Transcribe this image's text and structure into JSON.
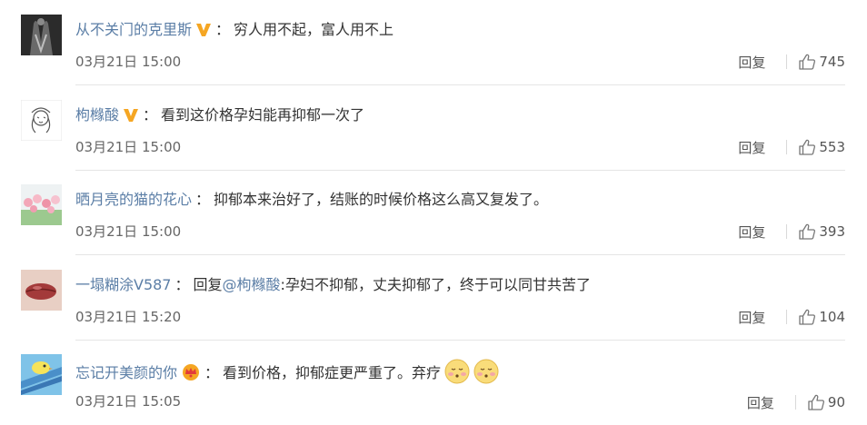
{
  "comments": [
    {
      "username": "从不关门的克里斯",
      "badge": "verified-v-icon",
      "colon": "：",
      "text": "穷人用不起，富人用不上",
      "time": "03月21日 15:00",
      "reply_label": "回复",
      "likes": "745"
    },
    {
      "username": "枸橼酸",
      "badge": "verified-v-icon",
      "colon": "：",
      "text": "看到这价格孕妇能再抑郁一次了",
      "time": "03月21日 15:00",
      "reply_label": "回复",
      "likes": "553"
    },
    {
      "username": "晒月亮的猫的花心",
      "colon": "：",
      "text": "抑郁本来治好了，结账的时候价格这么高又复发了。",
      "time": "03月21日 15:00",
      "reply_label": "回复",
      "likes": "393"
    },
    {
      "username": "一塌糊涂V587",
      "colon": "：",
      "reply_prefix": "回复",
      "mention": "@枸橼酸",
      "text": ":孕妇不抑郁，丈夫抑郁了，终于可以同甘共苦了",
      "time": "03月21日 15:20",
      "reply_label": "回复",
      "likes": "104"
    },
    {
      "username": "忘记开美颜的你",
      "badge": "crown-icon",
      "colon": "：",
      "text": "看到价格，抑郁症更严重了。弃疗",
      "emojis": [
        "embarrassed-face-icon",
        "embarrassed-face-icon"
      ],
      "time": "03月21日 15:05",
      "reply_label": "回复",
      "likes": "90"
    }
  ],
  "colors": {
    "username": "#5b7ea6",
    "text": "#333333",
    "meta": "#666666",
    "badge": "#f5a623",
    "divider": "#e5e5e5"
  }
}
